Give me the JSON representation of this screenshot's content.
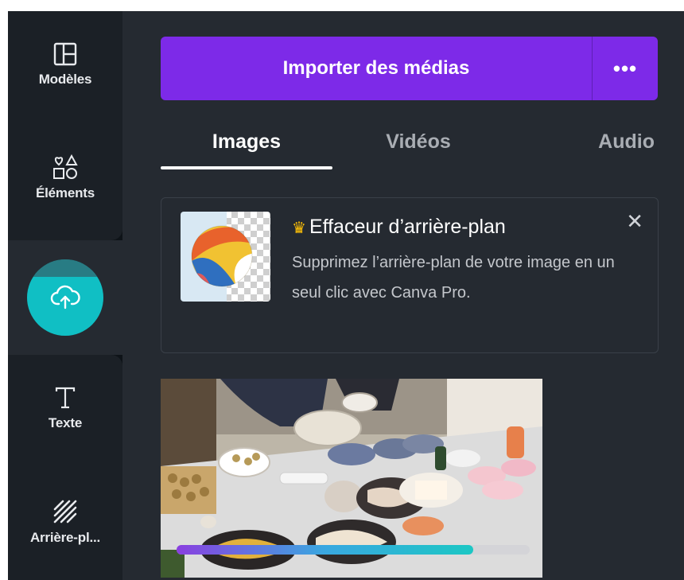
{
  "sidebar": {
    "items": [
      {
        "label": "Modèles",
        "icon": "templates-icon"
      },
      {
        "label": "Éléments",
        "icon": "elements-icon"
      },
      {
        "label": "",
        "icon": "upload-cloud-icon"
      },
      {
        "label": "Texte",
        "icon": "text-icon"
      },
      {
        "label": "Arrière-pl...",
        "icon": "background-icon"
      }
    ],
    "active_color": "#10bfc4"
  },
  "import": {
    "label": "Importer des médias",
    "more_label": "•••",
    "color": "#7d2ae8"
  },
  "tabs": [
    {
      "label": "Images",
      "active": true
    },
    {
      "label": "Vidéos",
      "active": false
    },
    {
      "label": "Audio",
      "active": false
    }
  ],
  "promo": {
    "crown_icon": "♛",
    "title": "Effaceur d’arrière-plan",
    "description": "Supprimez l’arrière-plan de votre image en un seul clic avec Canva Pro.",
    "close_label": "✕"
  },
  "upload": {
    "progress": 0.84
  }
}
